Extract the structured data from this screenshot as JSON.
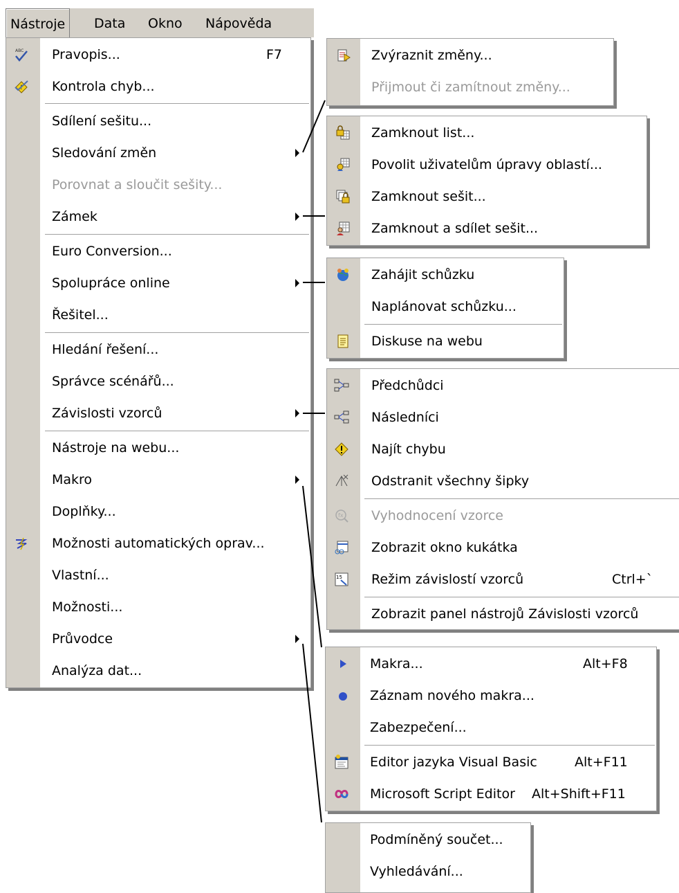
{
  "menubar": {
    "items": [
      "Nástroje",
      "Data",
      "Okno",
      "Nápověda"
    ]
  },
  "tools_menu": {
    "items": [
      {
        "label": "Pravopis...",
        "shortcut": "F7",
        "icon": "spellcheck-icon"
      },
      {
        "label": "Kontrola chyb...",
        "icon": "error-check-icon"
      },
      {
        "label": "Sdílení sešitu..."
      },
      {
        "label": "Sledování změn",
        "submenu": true
      },
      {
        "label": "Porovnat a sloučit sešity...",
        "disabled": true
      },
      {
        "label": "Zámek",
        "submenu": true
      },
      {
        "label": "Euro Conversion..."
      },
      {
        "label": "Spolupráce online",
        "submenu": true
      },
      {
        "label": "Řešitel..."
      },
      {
        "label": "Hledání řešení..."
      },
      {
        "label": "Správce scénářů..."
      },
      {
        "label": "Závislosti vzorců",
        "submenu": true
      },
      {
        "label": "Nástroje na webu..."
      },
      {
        "label": "Makro",
        "submenu": true
      },
      {
        "label": "Doplňky..."
      },
      {
        "label": "Možnosti automatických oprav...",
        "icon": "autocorrect-icon"
      },
      {
        "label": "Vlastní..."
      },
      {
        "label": "Možnosti..."
      },
      {
        "label": "Průvodce",
        "submenu": true
      },
      {
        "label": "Analýza dat..."
      }
    ]
  },
  "track_changes_menu": {
    "items": [
      {
        "label": "Zvýraznit změny...",
        "icon": "highlight-changes-icon"
      },
      {
        "label": "Přijmout či zamítnout změny...",
        "disabled": true
      }
    ]
  },
  "protection_menu": {
    "items": [
      {
        "label": "Zamknout list...",
        "icon": "lock-sheet-icon"
      },
      {
        "label": "Povolit uživatelům úpravy oblastí...",
        "icon": "allow-edit-ranges-icon"
      },
      {
        "label": "Zamknout sešit...",
        "icon": "lock-workbook-icon"
      },
      {
        "label": "Zamknout a sdílet sešit...",
        "icon": "lock-share-workbook-icon"
      }
    ]
  },
  "collaboration_menu": {
    "items": [
      {
        "label": "Zahájit schůzku",
        "icon": "meet-now-icon"
      },
      {
        "label": "Naplánovat schůzku..."
      },
      {
        "label": "Diskuse na webu",
        "icon": "web-discussion-icon"
      }
    ]
  },
  "formula_auditing_menu": {
    "items": [
      {
        "label": "Předchůdci",
        "icon": "trace-precedents-icon"
      },
      {
        "label": "Následníci",
        "icon": "trace-dependents-icon"
      },
      {
        "label": "Najít chybu",
        "icon": "trace-error-icon"
      },
      {
        "label": "Odstranit všechny šipky",
        "icon": "remove-arrows-icon"
      },
      {
        "label": "Vyhodnocení vzorce",
        "icon": "evaluate-formula-icon",
        "disabled": true
      },
      {
        "label": "Zobrazit okno kukátka",
        "icon": "watch-window-icon"
      },
      {
        "label": "Režim závislostí vzorců",
        "shortcut": "Ctrl+`",
        "icon": "formula-auditing-mode-icon"
      },
      {
        "label": "Zobrazit panel nástrojů Závislosti vzorců"
      }
    ]
  },
  "macro_menu": {
    "items": [
      {
        "label": "Makra...",
        "shortcut": "Alt+F8",
        "icon": "run-macro-icon"
      },
      {
        "label": "Záznam nového makra...",
        "icon": "record-macro-icon"
      },
      {
        "label": "Zabezpečení..."
      },
      {
        "label": "Editor jazyka Visual Basic",
        "shortcut": "Alt+F11",
        "icon": "vb-editor-icon"
      },
      {
        "label": "Microsoft Script Editor",
        "shortcut": "Alt+Shift+F11",
        "icon": "script-editor-icon"
      }
    ]
  },
  "wizard_menu": {
    "items": [
      {
        "label": "Podmíněný součet..."
      },
      {
        "label": "Vyhledávání..."
      }
    ]
  },
  "colors": {
    "menu_face": "#d4d0c8",
    "menu_background": "#ffffff",
    "disabled_text": "#9a9a9a",
    "connector_line": "#000000"
  }
}
